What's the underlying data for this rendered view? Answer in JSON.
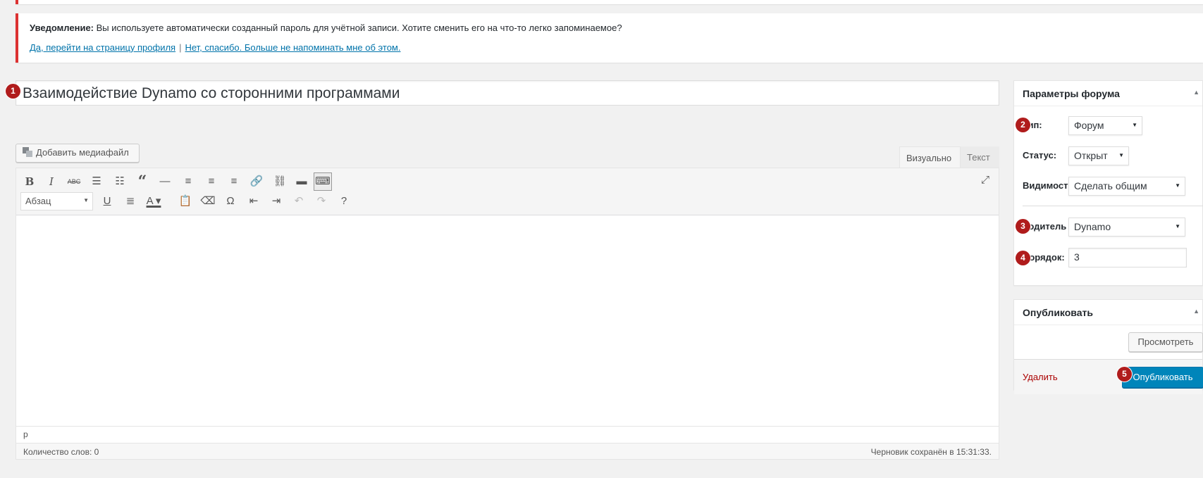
{
  "notice": {
    "label": "Уведомление:",
    "message": "Вы используете автоматически созданный пароль для учётной записи. Хотите сменить его на что-то легко запоминаемое?",
    "link_yes": "Да, перейти на страницу профиля",
    "separator": "|",
    "link_no": "Нет, спасибо. Больше не напоминать мне об этом."
  },
  "title": "Взаимодействие Dynamo со сторонними программами",
  "badges": [
    "1",
    "2",
    "3",
    "4",
    "5"
  ],
  "editor": {
    "media_button": "Добавить медиафайл",
    "tab_visual": "Визуально",
    "tab_text": "Текст",
    "format_select": "Абзац",
    "path": "p",
    "word_count": "Количество слов: 0",
    "draft_saved": "Черновик сохранён в 15:31:33.",
    "toolbar_row1": [
      "bold-icon",
      "italic-icon",
      "strikethrough-icon",
      "bullet-list-icon",
      "numbered-list-icon",
      "blockquote-icon",
      "horizontal-line-icon",
      "align-left-icon",
      "align-center-icon",
      "align-right-icon",
      "link-icon",
      "unlink-icon",
      "read-more-icon",
      "toolbar-toggle-icon",
      "fullscreen-icon"
    ],
    "toolbar_row2": [
      "underline-icon",
      "justify-icon",
      "text-color-icon",
      "paste-text-icon",
      "clear-formatting-icon",
      "special-character-icon",
      "outdent-icon",
      "indent-icon",
      "undo-icon",
      "redo-icon",
      "help-icon"
    ]
  },
  "forum_params": {
    "header": "Параметры форума",
    "type_label": "Тип:",
    "type_value": "Форум",
    "status_label": "Статус:",
    "status_value": "Открыт",
    "visibility_label": "Видимост",
    "visibility_value": "Сделать общим",
    "parent_label": "Родитель",
    "parent_value": "Dynamo",
    "order_label": "Порядок:",
    "order_value": "3"
  },
  "publish": {
    "header": "Опубликовать",
    "preview": "Просмотреть",
    "delete": "Удалить",
    "publish": "Опубликовать"
  },
  "colors": {
    "accent": "#0085ba",
    "notice_border": "#dc3232",
    "badge": "#b01c1c",
    "delete": "#aa0000"
  }
}
